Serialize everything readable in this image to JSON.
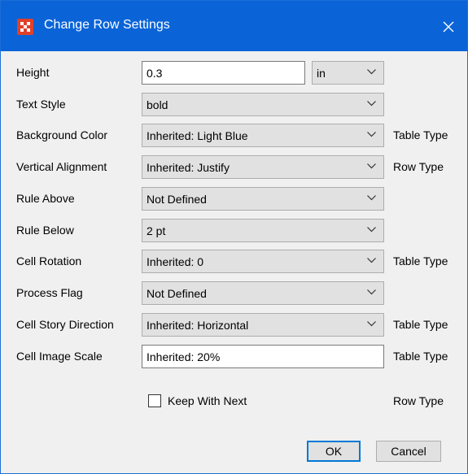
{
  "window": {
    "title": "Change Row Settings",
    "icon": "grid-app-icon"
  },
  "rows": [
    {
      "label": "Height",
      "type": "text",
      "value": "0.3",
      "unit": "in",
      "scope": ""
    },
    {
      "label": "Text Style",
      "type": "combo",
      "value": "bold",
      "scope": ""
    },
    {
      "label": "Background Color",
      "type": "combo",
      "value": "Inherited: Light Blue",
      "scope": "Table Type"
    },
    {
      "label": "Vertical Alignment",
      "type": "combo",
      "value": "Inherited: Justify",
      "scope": "Row Type"
    },
    {
      "label": "Rule Above",
      "type": "combo",
      "value": "Not Defined",
      "scope": ""
    },
    {
      "label": "Rule Below",
      "type": "combo",
      "value": "2 pt",
      "scope": ""
    },
    {
      "label": "Cell Rotation",
      "type": "combo",
      "value": "Inherited: 0",
      "scope": "Table Type"
    },
    {
      "label": "Process Flag",
      "type": "combo",
      "value": "Not Defined",
      "scope": ""
    },
    {
      "label": "Cell Story Direction",
      "type": "combo",
      "value": "Inherited: Horizontal",
      "scope": "Table Type"
    },
    {
      "label": "Cell Image Scale",
      "type": "text",
      "value": "Inherited: 20%",
      "scope": "Table Type"
    }
  ],
  "keep_with_next": {
    "label": "Keep With Next",
    "checked": false,
    "scope": "Row Type"
  },
  "buttons": {
    "ok": "OK",
    "cancel": "Cancel"
  }
}
